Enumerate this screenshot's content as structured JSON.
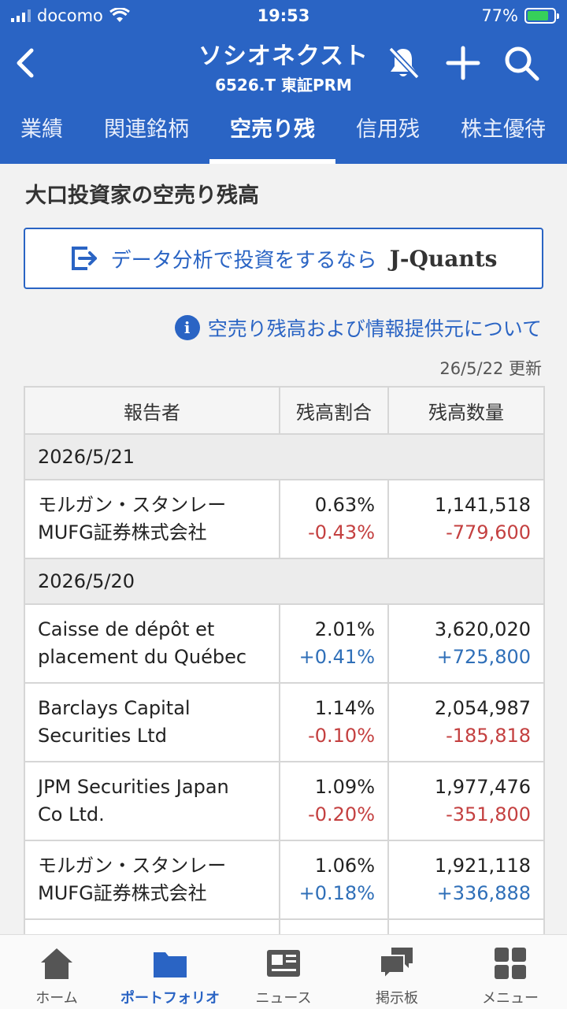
{
  "status": {
    "carrier": "docomo",
    "time": "19:53",
    "battery": "77%"
  },
  "header": {
    "title": "ソシオネクスト",
    "subtitle": "6526.T 東証PRM"
  },
  "tabs": [
    "業績",
    "関連銘柄",
    "空売り残",
    "信用残",
    "株主優待"
  ],
  "active_tab": "空売り残",
  "section_title": "大口投資家の空売り残高",
  "banner": {
    "text": "データ分析で投資をするなら",
    "brand": "J-Quants"
  },
  "info_link": "空売り残高および情報提供元について",
  "updated": "26/5/22 更新",
  "table": {
    "headers": [
      "報告者",
      "残高割合",
      "残高数量"
    ],
    "groups": [
      {
        "date": "2026/5/21",
        "rows": [
          {
            "name1": "モルガン・スタンレー",
            "name2": "MUFG証券株式会社",
            "ratio": "0.63%",
            "ratio_change": "-0.43%",
            "qty": "1,141,518",
            "qty_change": "-779,600"
          }
        ]
      },
      {
        "date": "2026/5/20",
        "rows": [
          {
            "name1": "Caisse de dépôt et",
            "name2": "placement du Québec",
            "ratio": "2.01%",
            "ratio_change": "+0.41%",
            "qty": "3,620,020",
            "qty_change": "+725,800"
          },
          {
            "name1": "Barclays Capital",
            "name2": "Securities Ltd",
            "ratio": "1.14%",
            "ratio_change": "-0.10%",
            "qty": "2,054,987",
            "qty_change": "-185,818"
          },
          {
            "name1": "JPM Securities Japan",
            "name2": "Co Ltd.",
            "ratio": "1.09%",
            "ratio_change": "-0.20%",
            "qty": "1,977,476",
            "qty_change": "-351,800"
          },
          {
            "name1": "モルガン・スタンレー",
            "name2": "MUFG証券株式会社",
            "ratio": "1.06%",
            "ratio_change": "+0.18%",
            "qty": "1,921,118",
            "qty_change": "+336,888"
          }
        ]
      }
    ]
  },
  "bottom_nav": [
    "ホーム",
    "ポートフォリオ",
    "ニュース",
    "掲示板",
    "メニュー"
  ],
  "colors": {
    "brand": "#2a64c4",
    "positive": "#2f6fb8",
    "negative": "#c44040"
  }
}
